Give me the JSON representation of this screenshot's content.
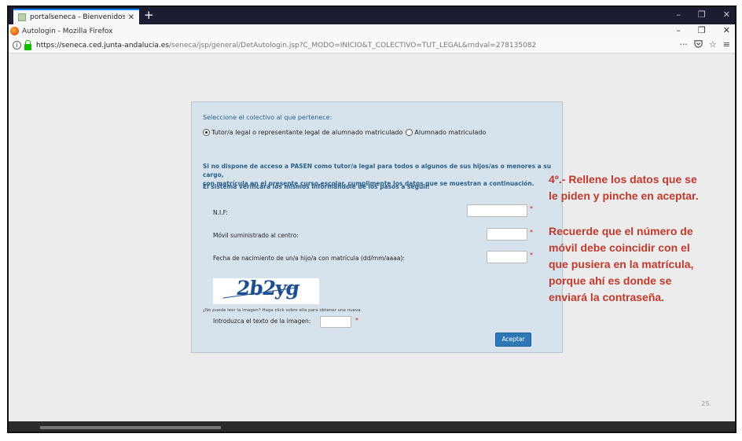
{
  "browser": {
    "tab_title": "portalseneca - Bienvenidos al P",
    "tab_close": "✕",
    "new_tab": "+",
    "window_title": "Autologin - Mozilla Firefox",
    "url_domain": "https://seneca.ced.junta-andalucia.es",
    "url_path": "/seneca/jsp/general/DetAutologin.jsp?C_MODO=INICIO&T_COLECTIVO=TUT_LEGAL&rndval=278135082",
    "url_more": "···",
    "minimize": "–",
    "restore": "❐",
    "close": "✕"
  },
  "form": {
    "heading": "Seleccione el colectivo al que pertenece:",
    "radio_tutor": "Tutor/a legal o representante legal de alumnado matriculado",
    "radio_alumnado": "Alumnado matriculado",
    "info_line1": "Si no dispone de acceso a PASEN como tutor/a legal para todos o algunos de sus hijos/as o menores a su cargo,",
    "info_line2": "con matrícula en el presente curso escolar, cumplimente los datos que se muestran a continuación.",
    "info_line3": "El sistema verificará los mismos informándole de los pasos a seguir.",
    "nif_label": "N.I.F:",
    "movil_label": "Móvil suministrado al centro:",
    "fecha_label": "Fecha de nacimiento de un/a hijo/a con matrícula (dd/mm/aaaa):",
    "required_mark": "*",
    "captcha_text": "2b2yg",
    "captcha_help": "¿No puede leer la imagen? Haga click sobre ella para obtener una nueva.",
    "captcha_label": "Introduzca el texto de la imagen:",
    "accept_label": "Aceptar"
  },
  "annotation": {
    "line1": "4º.- Rellene los datos que se",
    "line2": "le piden y pinche en aceptar.",
    "line3": "Recuerde que el número de",
    "line4": "móvil debe coincidir con el",
    "line5": "que pusiera en la matrícula,",
    "line6": "porque ahí es donde se",
    "line7": "enviará la contraseña."
  },
  "page_corner_text": "2S.",
  "colors": {
    "annotation": "#c0392b",
    "form_accent": "#2a5f8a",
    "accept_button": "#2e78b8"
  }
}
